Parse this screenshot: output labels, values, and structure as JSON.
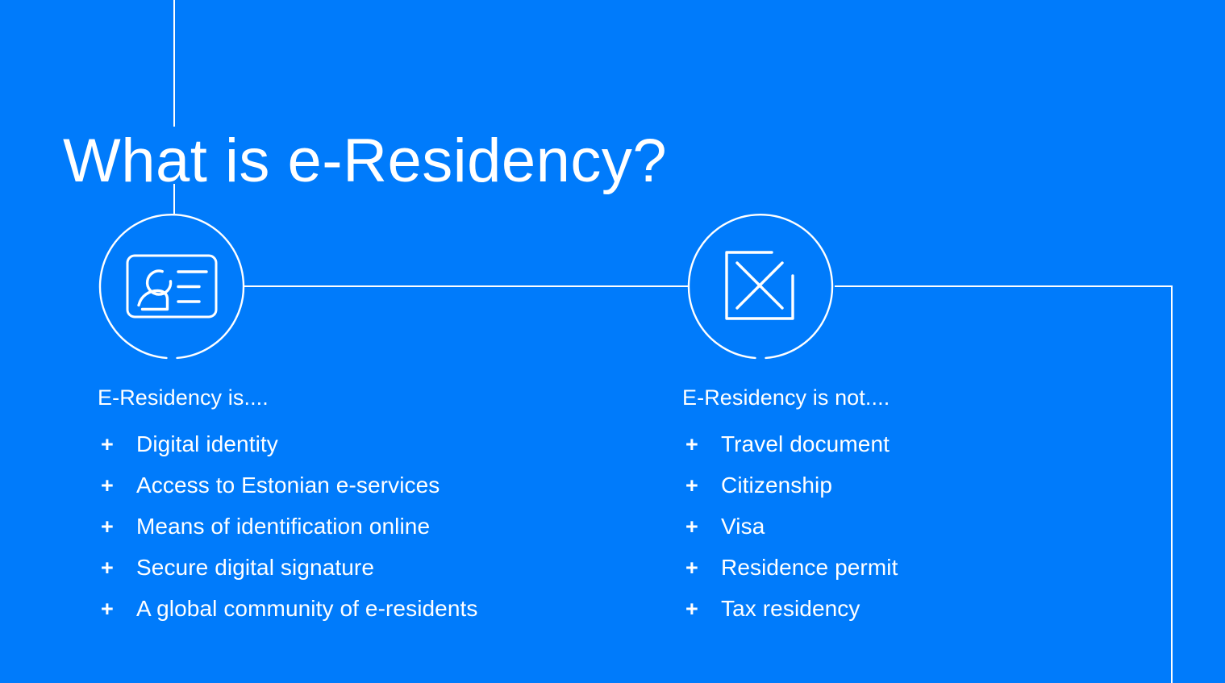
{
  "slide": {
    "title": "What is e-Residency?",
    "background_color": "#007bfb",
    "foreground_color": "#ffffff"
  },
  "columns": [
    {
      "id": "is",
      "icon_name": "id-card-icon",
      "heading": "E-Residency is....",
      "bullet_marker": "+",
      "items": [
        "Digital identity",
        "Access to Estonian e-services",
        "Means of identification online",
        "Secure digital signature",
        "A global community of e-residents"
      ]
    },
    {
      "id": "is-not",
      "icon_name": "crossed-box-icon",
      "heading": "E-Residency is not....",
      "bullet_marker": "+",
      "items": [
        "Travel document",
        "Citizenship",
        "Visa",
        "Residence permit",
        "Tax residency"
      ]
    }
  ]
}
